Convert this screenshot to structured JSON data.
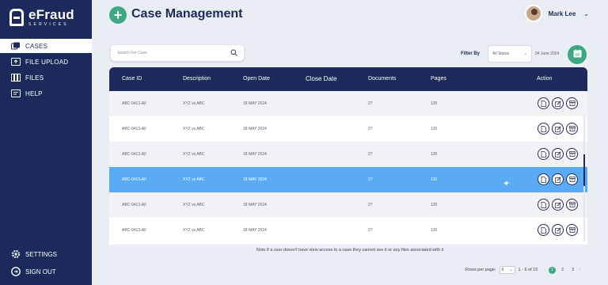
{
  "brand": {
    "name": "eFraud",
    "tagline": "SERVICES"
  },
  "sidebar": {
    "items": [
      {
        "label": "CASES",
        "icon": "cases-icon",
        "active": true
      },
      {
        "label": "FILE UPLOAD",
        "icon": "file-upload-icon",
        "active": false
      },
      {
        "label": "FILES",
        "icon": "files-icon",
        "active": false
      },
      {
        "label": "HELP",
        "icon": "help-icon",
        "active": false
      }
    ],
    "bottom": [
      {
        "label": "SETTINGS",
        "icon": "gear-icon"
      },
      {
        "label": "SIGN OUT",
        "icon": "sign-out-icon"
      }
    ]
  },
  "header": {
    "title": "Case Management",
    "add_symbol": "+",
    "user_name": "Mark Lee",
    "user_chevron": "⌄"
  },
  "search": {
    "placeholder": "Search For Case"
  },
  "filter": {
    "label": "Filter By",
    "status_value": "All Status",
    "status_arrow": "⌄",
    "date": "04 June 2024"
  },
  "table": {
    "columns": [
      "Case ID",
      "Description",
      "Open Date",
      "Close Date",
      "Documents",
      "Pages",
      "Action"
    ],
    "rows": [
      {
        "case_id": "ABC-0413-AF",
        "description": "XYZ vs ABC",
        "open_date": "18 MAY 2024",
        "close_date": "",
        "documents": "27",
        "pages": "120"
      },
      {
        "case_id": "ABC-0413-AF",
        "description": "XYZ vs ABC",
        "open_date": "18 MAY 2024",
        "close_date": "",
        "documents": "27",
        "pages": "120"
      },
      {
        "case_id": "ABC-0413-AF",
        "description": "XYZ vs ABC",
        "open_date": "18 MAY 2024",
        "close_date": "",
        "documents": "27",
        "pages": "120"
      },
      {
        "case_id": "ABC-0413-AF",
        "description": "XYZ vs ABC",
        "open_date": "18 MAY 2024",
        "close_date": "",
        "documents": "27",
        "pages": "120"
      },
      {
        "case_id": "ABC-0413-AF",
        "description": "XYZ vs ABC",
        "open_date": "18 MAY 2024",
        "close_date": "",
        "documents": "27",
        "pages": "120"
      },
      {
        "case_id": "ABC-0413-AF",
        "description": "XYZ vs ABC",
        "open_date": "18 MAY 2024",
        "close_date": "",
        "documents": "27",
        "pages": "120"
      }
    ],
    "selected_row": 3,
    "action_icons": [
      "view-document-icon",
      "edit-icon",
      "archive-icon"
    ]
  },
  "note": "Note if a user doesn't have view access to a case they cannot see it or any files associated with it",
  "pagination": {
    "rows_per_page_label": "Rows per page:",
    "rows_per_page": "6",
    "range": "1 - 6 of 15",
    "prev": "‹",
    "next": "›",
    "pages": [
      "1",
      "2",
      "3"
    ],
    "current_page": "1"
  },
  "colors": {
    "sidebar": "#1b2a5a",
    "accent_green": "#3fa883",
    "selected_row": "#5aaaf4",
    "background": "#e9edf4"
  }
}
